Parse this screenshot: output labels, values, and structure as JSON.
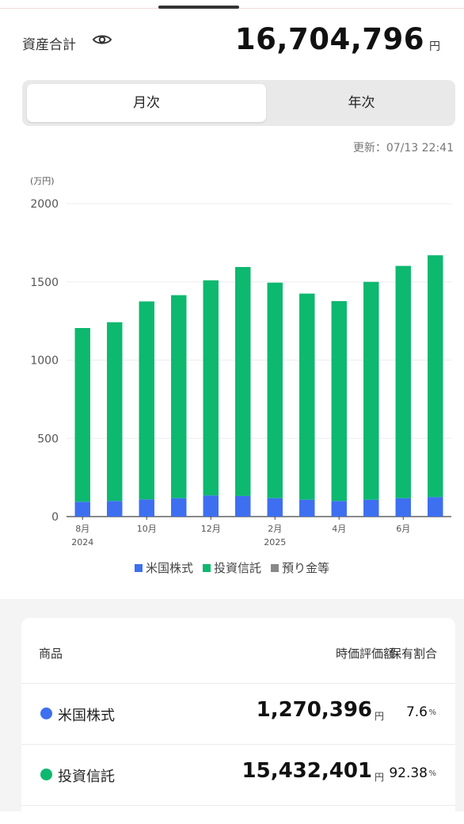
{
  "header": {
    "total_label": "資産合計",
    "total_value": "16,704,796",
    "total_unit": "円"
  },
  "tabs": [
    {
      "label": "月次",
      "active": true
    },
    {
      "label": "年次",
      "active": false
    }
  ],
  "updated_text": "更新：07/13 22:41",
  "chart_data": {
    "type": "bar",
    "stacked": true,
    "unit_label": "(万円)",
    "ylim": [
      0,
      2000
    ],
    "y_ticks": [
      0,
      500,
      1000,
      1500,
      2000
    ],
    "categories": [
      "2024-08",
      "2024-09",
      "2024-10",
      "2024-11",
      "2024-12",
      "2025-01",
      "2025-02",
      "2025-03",
      "2025-04",
      "2025-05",
      "2025-06",
      "2025-07"
    ],
    "x_tick_labels": [
      {
        "index": 0,
        "month": "8月",
        "year": "2024"
      },
      {
        "index": 2,
        "month": "10月",
        "year": ""
      },
      {
        "index": 4,
        "month": "12月",
        "year": ""
      },
      {
        "index": 6,
        "month": "2月",
        "year": "2025"
      },
      {
        "index": 8,
        "month": "4月",
        "year": ""
      },
      {
        "index": 10,
        "month": "6月",
        "year": ""
      }
    ],
    "series": [
      {
        "name": "米国株式",
        "color": "#3d6ff0",
        "values": [
          95,
          100,
          110,
          118,
          135,
          132,
          118,
          108,
          100,
          108,
          118,
          125
        ]
      },
      {
        "name": "投資信託",
        "color": "#0db86f",
        "values": [
          1110,
          1142,
          1265,
          1297,
          1375,
          1463,
          1377,
          1317,
          1277,
          1392,
          1484,
          1545
        ]
      },
      {
        "name": "預り金等",
        "color": "#888888",
        "values": [
          0,
          0,
          0,
          0,
          0,
          0,
          0,
          0,
          0,
          0,
          0,
          0
        ]
      }
    ],
    "grid": true,
    "legend_position": "bottom"
  },
  "holdings": {
    "col_product": "商品",
    "col_value": "時価評価額",
    "col_ratio": "保有割合",
    "rows": [
      {
        "name": "米国株式",
        "color": "#3d6ff0",
        "value": "1,270,396",
        "unit": "円",
        "ratio": "7.6",
        "ratio_unit": "%"
      },
      {
        "name": "投資信託",
        "color": "#0db86f",
        "value": "15,432,401",
        "unit": "円",
        "ratio": "92.38",
        "ratio_unit": "%"
      }
    ]
  }
}
